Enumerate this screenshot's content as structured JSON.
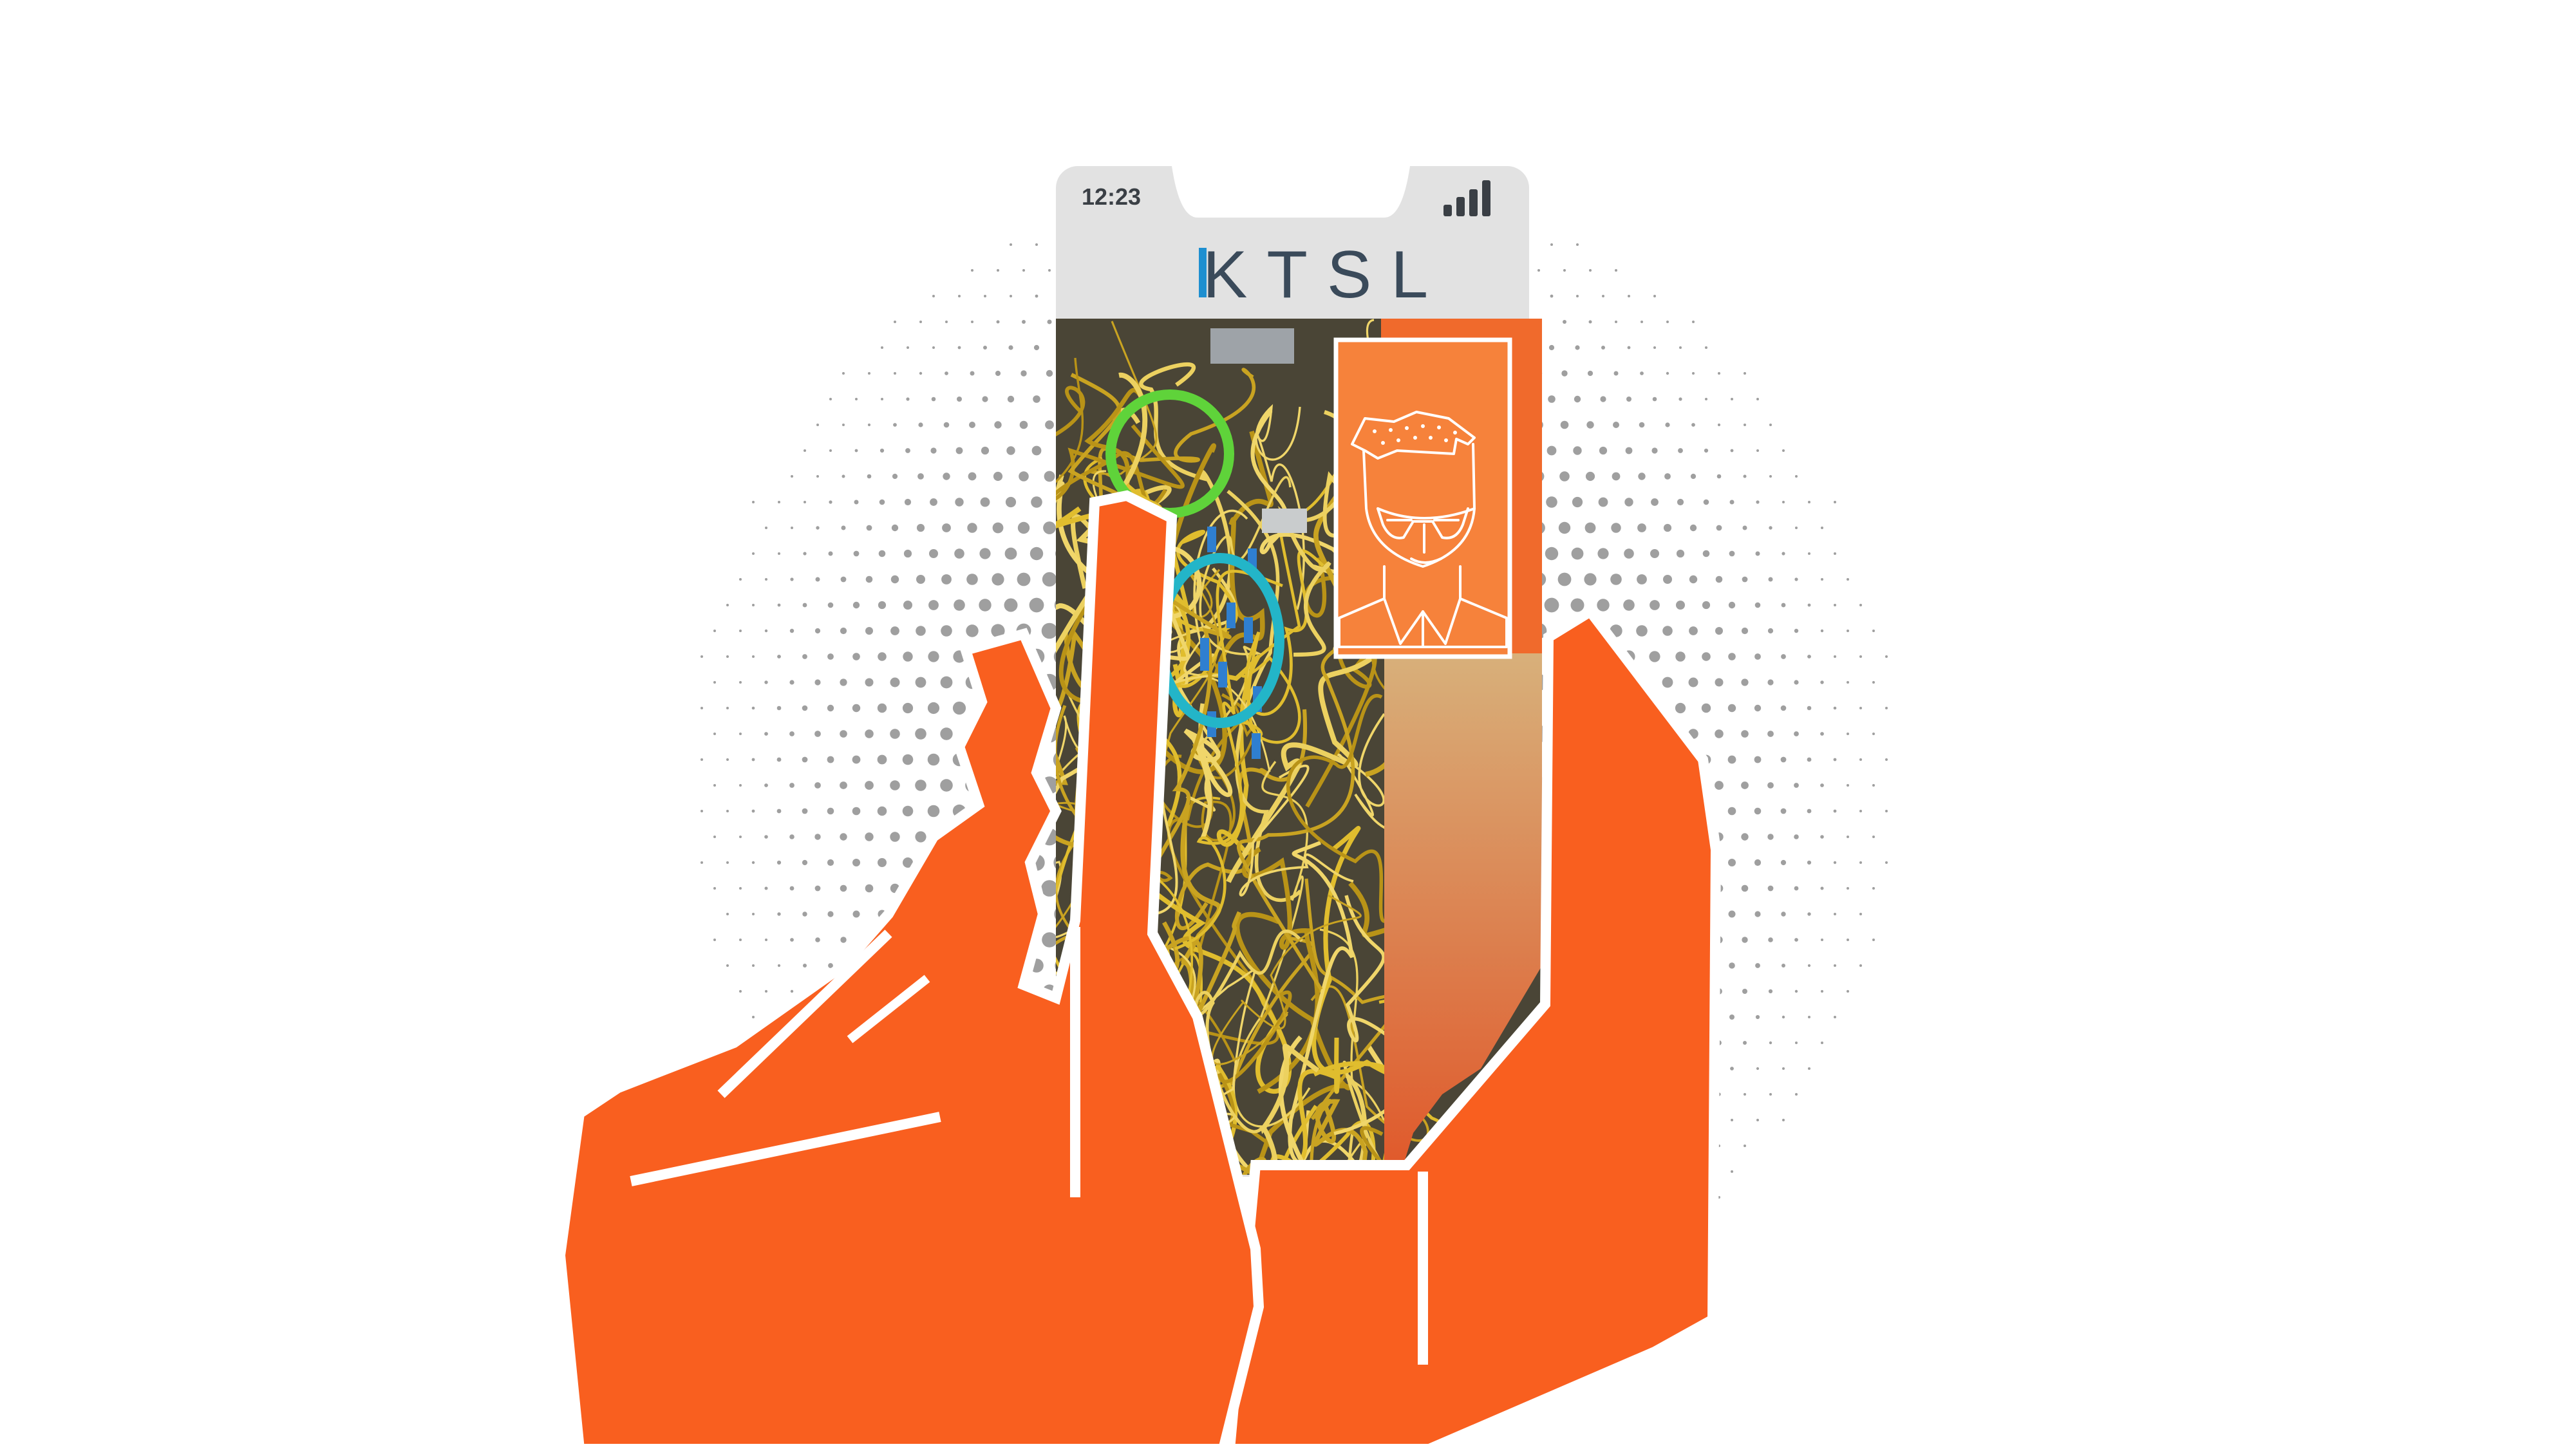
{
  "phone": {
    "status_time": "12:23",
    "signal_icon": "signal-bars-icon",
    "brand_logo": "KTSL"
  },
  "colors": {
    "hand": "#f95f1f",
    "panel": "#f36b2a",
    "avatar_bg": "#f6813c",
    "ring_green": "#5fd33a",
    "ring_teal": "#23b5c8",
    "phone_frame": "#e3e3e3",
    "logo_accent": "#1e8fd0",
    "dots": "#9f9f9f",
    "cables": "#d8b52b"
  },
  "icons": [
    "signal-bars-icon",
    "engineer-avatar-icon",
    "focus-ring-icon"
  ]
}
